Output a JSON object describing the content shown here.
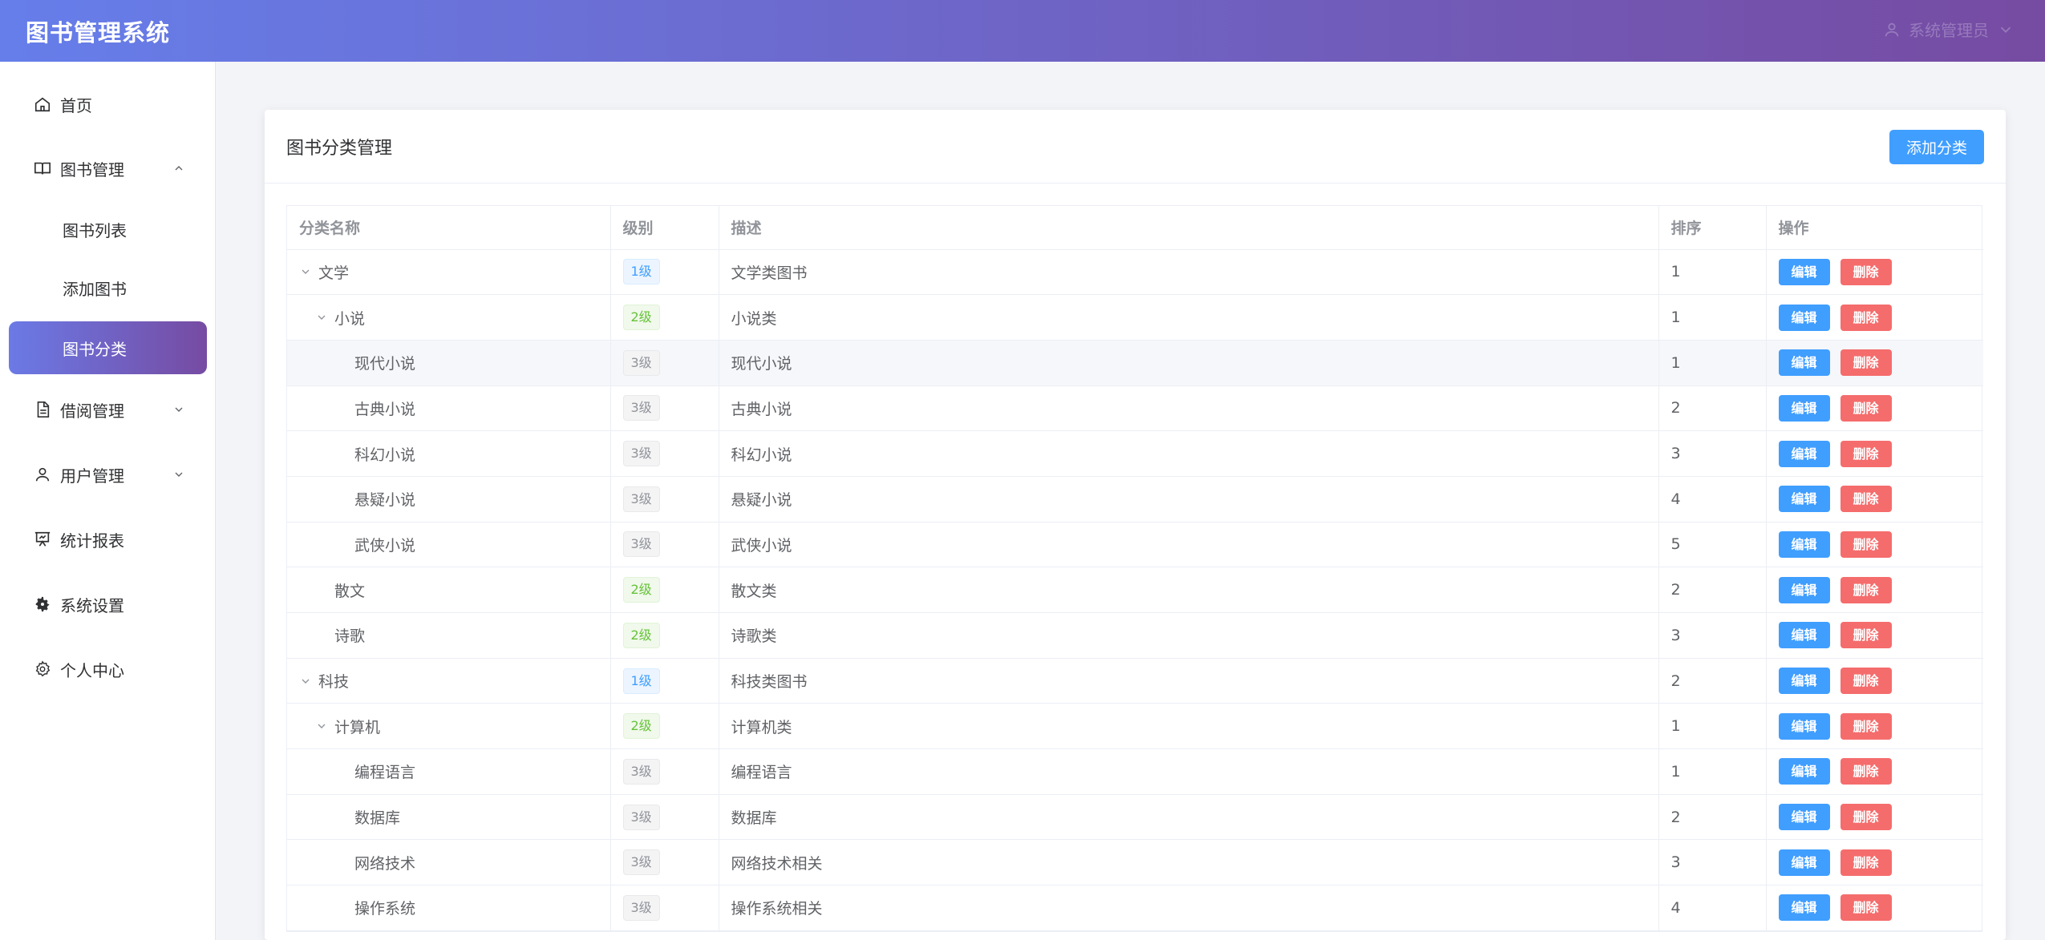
{
  "header": {
    "title": "图书管理系统",
    "user_label": "系统管理员"
  },
  "sidebar": {
    "items": [
      {
        "label": "首页",
        "icon": "home-icon"
      },
      {
        "label": "图书管理",
        "icon": "book-icon",
        "expanded": true
      },
      {
        "label": "图书列表"
      },
      {
        "label": "添加图书"
      },
      {
        "label": "图书分类",
        "active": true
      },
      {
        "label": "借阅管理",
        "icon": "document-icon",
        "expanded": false
      },
      {
        "label": "用户管理",
        "icon": "user-icon",
        "expanded": false
      },
      {
        "label": "统计报表",
        "icon": "chart-board-icon"
      },
      {
        "label": "系统设置",
        "icon": "gear-filled-icon"
      },
      {
        "label": "个人中心",
        "icon": "gear-outline-icon"
      }
    ]
  },
  "card": {
    "title": "图书分类管理",
    "add_button": "添加分类"
  },
  "table": {
    "headers": [
      "分类名称",
      "级别",
      "描述",
      "排序",
      "操作"
    ],
    "edit_label": "编辑",
    "delete_label": "删除",
    "rows": [
      {
        "name": "文学",
        "level": "1级",
        "desc": "文学类图书",
        "sort": "1"
      },
      {
        "name": "小说",
        "level": "2级",
        "desc": "小说类",
        "sort": "1"
      },
      {
        "name": "现代小说",
        "level": "3级",
        "desc": "现代小说",
        "sort": "1"
      },
      {
        "name": "古典小说",
        "level": "3级",
        "desc": "古典小说",
        "sort": "2"
      },
      {
        "name": "科幻小说",
        "level": "3级",
        "desc": "科幻小说",
        "sort": "3"
      },
      {
        "name": "悬疑小说",
        "level": "3级",
        "desc": "悬疑小说",
        "sort": "4"
      },
      {
        "name": "武侠小说",
        "level": "3级",
        "desc": "武侠小说",
        "sort": "5"
      },
      {
        "name": "散文",
        "level": "2级",
        "desc": "散文类",
        "sort": "2"
      },
      {
        "name": "诗歌",
        "level": "2级",
        "desc": "诗歌类",
        "sort": "3"
      },
      {
        "name": "科技",
        "level": "1级",
        "desc": "科技类图书",
        "sort": "2"
      },
      {
        "name": "计算机",
        "level": "2级",
        "desc": "计算机类",
        "sort": "1"
      },
      {
        "name": "编程语言",
        "level": "3级",
        "desc": "编程语言",
        "sort": "1"
      },
      {
        "name": "数据库",
        "level": "3级",
        "desc": "数据库",
        "sort": "2"
      },
      {
        "name": "网络技术",
        "level": "3级",
        "desc": "网络技术相关",
        "sort": "3"
      },
      {
        "name": "操作系统",
        "level": "3级",
        "desc": "操作系统相关",
        "sort": "4"
      }
    ]
  },
  "colors": {
    "header_gradient_start": "#667eea",
    "header_gradient_end": "#764ba2",
    "primary": "#409eff",
    "danger": "#f56c6c"
  }
}
